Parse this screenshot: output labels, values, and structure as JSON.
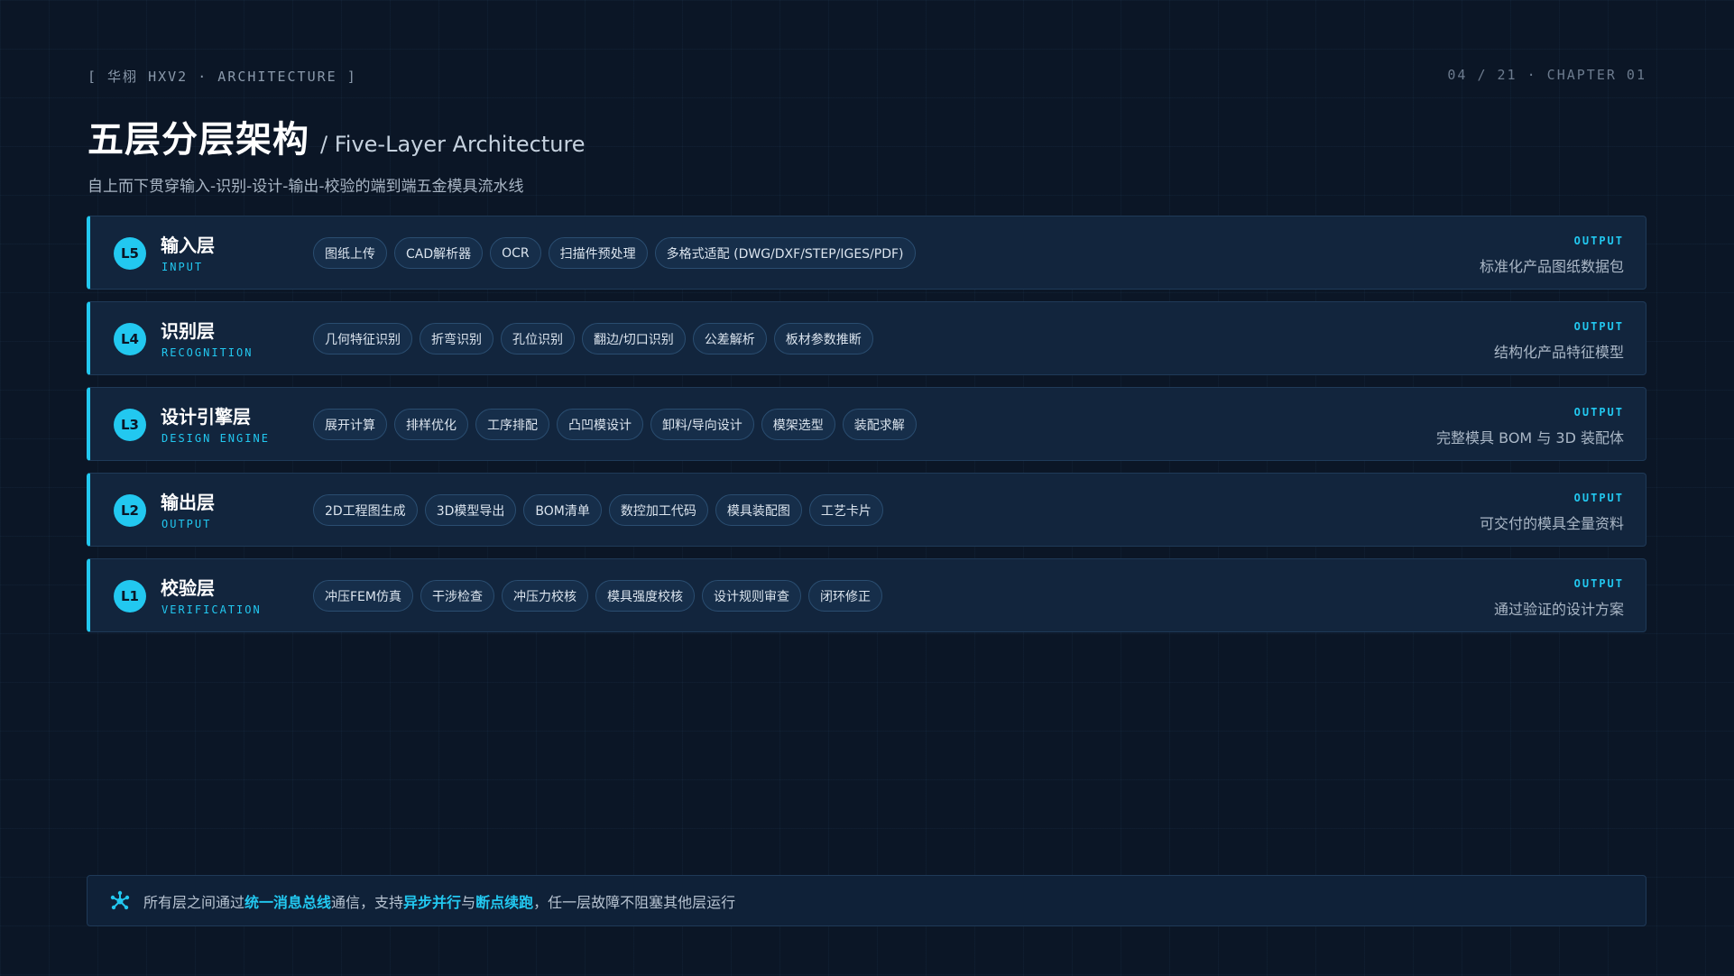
{
  "header": {
    "crumb": "[ 华栩 HXV2 · ARCHITECTURE ]",
    "pager": "04 / 21 · CHAPTER 01",
    "title": "五层分层架构",
    "title_en": "/ Five-Layer Architecture",
    "subtitle": "自上而下贯穿输入-识别-设计-输出-校验的端到端五金模具流水线"
  },
  "output_label": "OUTPUT",
  "layers": [
    {
      "badge": "L5",
      "name": "输入层",
      "name_en": "INPUT",
      "tags": [
        "图纸上传",
        "CAD解析器",
        "OCR",
        "扫描件预处理",
        "多格式适配 (DWG/DXF/STEP/IGES/PDF)"
      ],
      "output": "标准化产品图纸数据包"
    },
    {
      "badge": "L4",
      "name": "识别层",
      "name_en": "RECOGNITION",
      "tags": [
        "几何特征识别",
        "折弯识别",
        "孔位识别",
        "翻边/切口识别",
        "公差解析",
        "板材参数推断"
      ],
      "output": "结构化产品特征模型"
    },
    {
      "badge": "L3",
      "name": "设计引擎层",
      "name_en": "DESIGN ENGINE",
      "tags": [
        "展开计算",
        "排样优化",
        "工序排配",
        "凸凹模设计",
        "卸料/导向设计",
        "模架选型",
        "装配求解"
      ],
      "output": "完整模具 BOM 与 3D 装配体"
    },
    {
      "badge": "L2",
      "name": "输出层",
      "name_en": "OUTPUT",
      "tags": [
        "2D工程图生成",
        "3D模型导出",
        "BOM清单",
        "数控加工代码",
        "模具装配图",
        "工艺卡片"
      ],
      "output": "可交付的模具全量资料"
    },
    {
      "badge": "L1",
      "name": "校验层",
      "name_en": "VERIFICATION",
      "tags": [
        "冲压FEM仿真",
        "干涉检查",
        "冲压力校核",
        "模具强度校核",
        "设计规则审查",
        "闭环修正"
      ],
      "output": "通过验证的设计方案"
    }
  ],
  "footer": {
    "icon": "hub-network-icon",
    "parts": [
      {
        "text": "所有层之间通过",
        "hl": false
      },
      {
        "text": "统一消息总线",
        "hl": true
      },
      {
        "text": "通信，支持",
        "hl": false
      },
      {
        "text": "异步并行",
        "hl": true
      },
      {
        "text": "与",
        "hl": false
      },
      {
        "text": "断点续跑",
        "hl": true
      },
      {
        "text": "，任一层故障不阻塞其他层运行",
        "hl": false
      }
    ]
  },
  "colors": {
    "accent": "#22c8f0",
    "background": "#0b1626",
    "card": "#12253d"
  }
}
